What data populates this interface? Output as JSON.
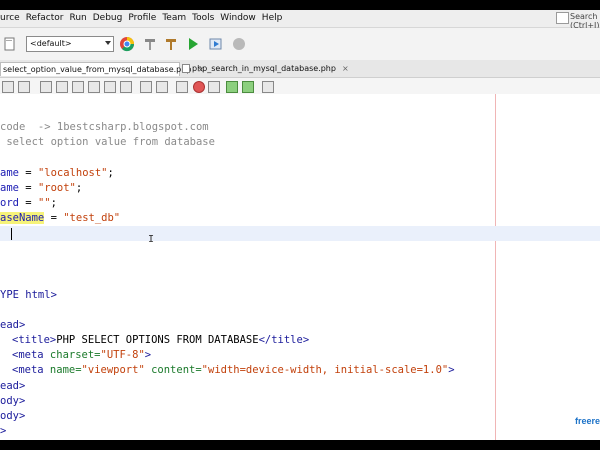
{
  "menubar": {
    "items": [
      "urce",
      "Refactor",
      "Run",
      "Debug",
      "Profile",
      "Team",
      "Tools",
      "Window",
      "Help"
    ],
    "search_placeholder": "Search (Ctrl+I)"
  },
  "toolbar": {
    "config_select": "<default>"
  },
  "tabs": [
    {
      "label": "select_option_value_from_mysql_database.php",
      "active": true
    },
    {
      "label": "php_search_in_mysql_database.php",
      "active": false
    }
  ],
  "editor": {
    "lines": [
      {
        "text": "code  -> 1bestcsharp.blogspot.com",
        "kind": "comment"
      },
      {
        "text": " select option value from database",
        "kind": "comment"
      },
      {
        "text": "",
        "kind": "blank"
      },
      {
        "var": "ame",
        "op": " = ",
        "str": "\"localhost\"",
        "end": ";"
      },
      {
        "var": "ame",
        "op": " = ",
        "str": "\"root\"",
        "end": ";"
      },
      {
        "var": "ord",
        "op": " = ",
        "str": "\"\"",
        "end": ";"
      },
      {
        "var": "aseName",
        "op": " = ",
        "str": "\"test_db\"",
        "end": ""
      },
      {
        "text": "",
        "kind": "cursor"
      },
      {
        "text": "",
        "kind": "blank"
      },
      {
        "text": "",
        "kind": "blank"
      },
      {
        "text": "",
        "kind": "blank"
      },
      {
        "text": "YPE html>",
        "kind": "tag"
      },
      {
        "text": "",
        "kind": "blank"
      },
      {
        "text": "ead>",
        "kind": "tag"
      },
      {
        "title_open": "<title>",
        "title_text": "PHP SELECT OPTIONS FROM DATABASE",
        "title_close": "</title>"
      },
      {
        "meta1_open": "<meta",
        "meta1_attr": " charset=",
        "meta1_val": "\"UTF-8\"",
        "meta1_close": ">"
      },
      {
        "meta2_open": "<meta",
        "meta2_a1": " name=",
        "meta2_v1": "\"viewport\"",
        "meta2_a2": " content=",
        "meta2_v2": "\"width=device-width, initial-scale=1.0\"",
        "meta2_close": ">"
      },
      {
        "text": "ead>",
        "kind": "tag"
      },
      {
        "text": "ody>",
        "kind": "tag"
      },
      {
        "text": "ody>",
        "kind": "tag"
      },
      {
        "text": ">",
        "kind": "tag"
      }
    ]
  },
  "watermark": "freere"
}
